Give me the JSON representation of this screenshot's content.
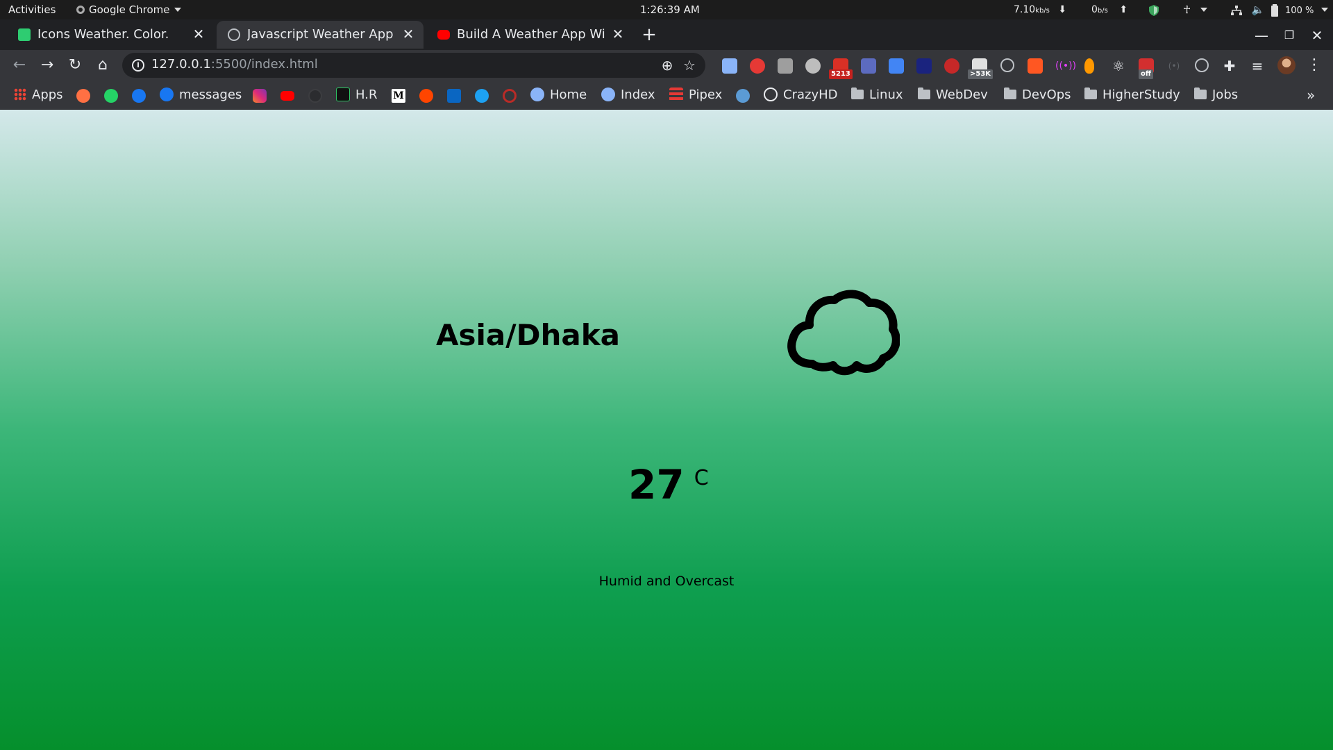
{
  "os": {
    "activities": "Activities",
    "app_menu": "Google Chrome",
    "clock": "1:26:39 AM",
    "net_down": "7.10",
    "net_down_unit": "kb/s",
    "net_up": "0",
    "net_up_unit": "b/s",
    "battery": "100 %"
  },
  "tabs": [
    {
      "title": "Icons Weather. Color.",
      "active": false,
      "favicon_color": "#2ecc71"
    },
    {
      "title": "Javascript Weather App",
      "active": true,
      "favicon_color": "#bdc1c6"
    },
    {
      "title": "Build A Weather App With",
      "active": false,
      "favicon_color": "#ff0000"
    }
  ],
  "toolbar": {
    "url_host": "127.0.0.1",
    "url_path": ":5500/index.html",
    "ext_badge_mail": "5213",
    "ext_badge_mail2": ">53K",
    "ext_badge_off": "off"
  },
  "bookmarks": {
    "apps": "Apps",
    "messages": "messages",
    "hr": "H.R",
    "home": "Home",
    "index": "Index",
    "pipex": "Pipex",
    "crazyhd": "CrazyHD",
    "linux": "Linux",
    "webdev": "WebDev",
    "devops": "DevOps",
    "higherstudy": "HigherStudy",
    "jobs": "Jobs",
    "overflow": "»"
  },
  "weather": {
    "timezone": "Asia/Dhaka",
    "temperature": "27",
    "unit": "C",
    "description": "Humid and Overcast",
    "icon": "cloudy-icon"
  },
  "colors": {
    "gradient_top": "#d4e8ea",
    "gradient_bottom": "#058f2c",
    "chrome_dark": "#202124",
    "chrome_toolbar": "#35363a"
  }
}
